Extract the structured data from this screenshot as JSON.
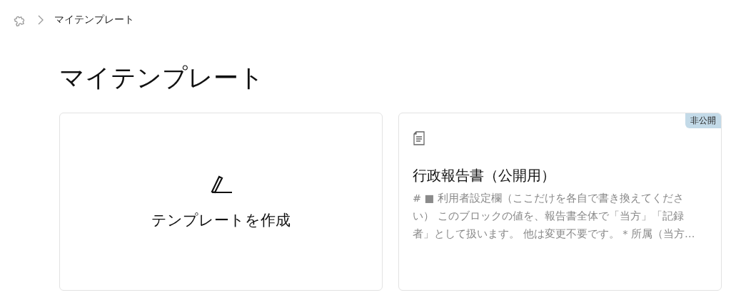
{
  "breadcrumb": {
    "current": "マイテンプレート"
  },
  "heading": "マイテンプレート",
  "cards": [
    {
      "kind": "create",
      "label": "テンプレートを作成"
    },
    {
      "kind": "template",
      "badge": "非公開",
      "title": "行政報告書（公開用）",
      "description": "# ■ 利用者設定欄（ここだけを各自で書き換えてください） このブロックの値を、報告書全体で「当方」「記録者」として扱います。 他は変更不要です。 * 所属（当方…"
    }
  ]
}
